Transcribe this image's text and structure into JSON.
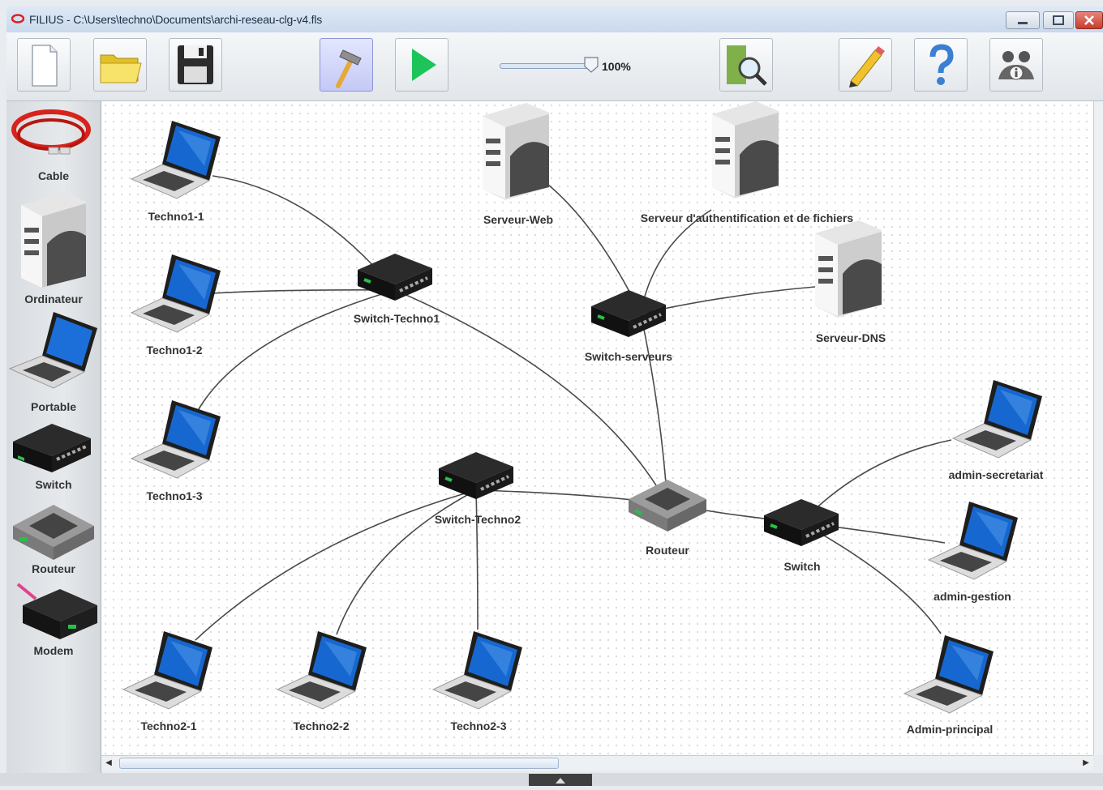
{
  "window": {
    "title": "FILIUS - C:\\Users\\techno\\Documents\\archi-reseau-clg-v4.fls",
    "minimize_icon": "minimize-icon",
    "maximize_icon": "maximize-icon",
    "close_icon": "close-icon"
  },
  "toolbar": {
    "buttons": [
      {
        "name": "new-file-button",
        "icon": "new-document-icon"
      },
      {
        "name": "open-file-button",
        "icon": "folder-icon"
      },
      {
        "name": "save-button",
        "icon": "floppy-disk-icon"
      },
      {
        "name": "design-mode-button",
        "icon": "hammer-icon",
        "active": true
      },
      {
        "name": "simulation-mode-button",
        "icon": "play-icon"
      },
      {
        "name": "documentation-button",
        "icon": "magnifier-icon"
      },
      {
        "name": "edit-button",
        "icon": "pencil-icon"
      },
      {
        "name": "help-button",
        "icon": "question-mark-icon"
      },
      {
        "name": "info-button",
        "icon": "info-people-icon"
      }
    ],
    "zoom_label": "100%",
    "zoom_value": 1.0
  },
  "palette": {
    "items": [
      {
        "label": "Cable",
        "icon": "cable-icon"
      },
      {
        "label": "Ordinateur",
        "icon": "server-icon"
      },
      {
        "label": "Portable",
        "icon": "laptop-icon"
      },
      {
        "label": "Switch",
        "icon": "switch-icon"
      },
      {
        "label": "Routeur",
        "icon": "router-icon"
      },
      {
        "label": "Modem",
        "icon": "modem-icon"
      }
    ]
  },
  "network": {
    "nodes": [
      {
        "id": "t11",
        "type": "laptop",
        "label": "Techno1-1"
      },
      {
        "id": "t12",
        "type": "laptop",
        "label": "Techno1-2"
      },
      {
        "id": "t13",
        "type": "laptop",
        "label": "Techno1-3"
      },
      {
        "id": "sw1",
        "type": "switch",
        "label": "Switch-Techno1"
      },
      {
        "id": "web",
        "type": "server",
        "label": "Serveur-Web"
      },
      {
        "id": "auth",
        "type": "server",
        "label": "Serveur d'authentification et de fichiers"
      },
      {
        "id": "dns",
        "type": "server",
        "label": "Serveur-DNS"
      },
      {
        "id": "swsrv",
        "type": "switch",
        "label": "Switch-serveurs"
      },
      {
        "id": "sw2",
        "type": "switch",
        "label": "Switch-Techno2"
      },
      {
        "id": "rt",
        "type": "router",
        "label": "Routeur"
      },
      {
        "id": "swadm",
        "type": "switch",
        "label": "Switch"
      },
      {
        "id": "t21",
        "type": "laptop",
        "label": "Techno2-1"
      },
      {
        "id": "t22",
        "type": "laptop",
        "label": "Techno2-2"
      },
      {
        "id": "t23",
        "type": "laptop",
        "label": "Techno2-3"
      },
      {
        "id": "asec",
        "type": "laptop",
        "label": "admin-secretariat"
      },
      {
        "id": "ages",
        "type": "laptop",
        "label": "admin-gestion"
      },
      {
        "id": "apri",
        "type": "laptop",
        "label": "Admin-principal"
      }
    ],
    "links": [
      [
        "t11",
        "sw1"
      ],
      [
        "t12",
        "sw1"
      ],
      [
        "t13",
        "sw1"
      ],
      [
        "sw1",
        "rt"
      ],
      [
        "web",
        "swsrv"
      ],
      [
        "auth",
        "swsrv"
      ],
      [
        "dns",
        "swsrv"
      ],
      [
        "swsrv",
        "rt"
      ],
      [
        "sw2",
        "rt"
      ],
      [
        "t21",
        "sw2"
      ],
      [
        "t22",
        "sw2"
      ],
      [
        "t23",
        "sw2"
      ],
      [
        "rt",
        "swadm"
      ],
      [
        "swadm",
        "asec"
      ],
      [
        "swadm",
        "ages"
      ],
      [
        "swadm",
        "apri"
      ]
    ]
  },
  "scrollbars": {
    "left_arrow": "◀",
    "right_arrow": "▶"
  }
}
